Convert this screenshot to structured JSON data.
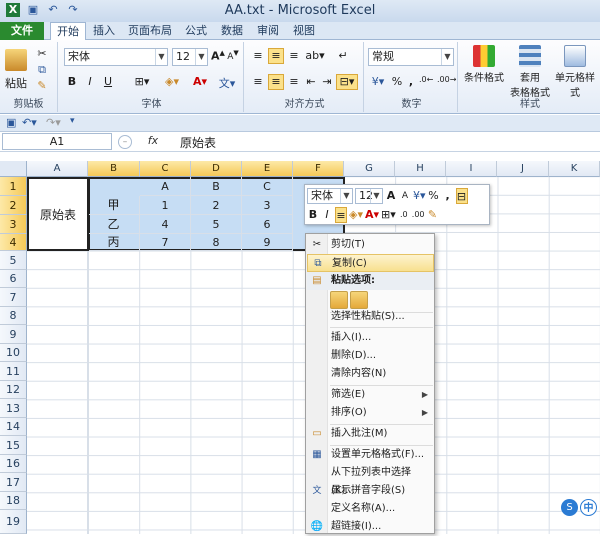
{
  "window": {
    "title": "AA.txt - Microsoft Excel"
  },
  "tabs": [
    {
      "label": "文件"
    },
    {
      "label": "开始"
    },
    {
      "label": "插入"
    },
    {
      "label": "页面布局"
    },
    {
      "label": "公式"
    },
    {
      "label": "数据"
    },
    {
      "label": "审阅"
    },
    {
      "label": "视图"
    }
  ],
  "ribbon": {
    "clipboard": {
      "paste": "粘贴",
      "label": "剪贴板"
    },
    "font": {
      "name": "宋体",
      "size": "12",
      "bold": "B",
      "italic": "I",
      "underline": "U",
      "label": "字体"
    },
    "alignment": {
      "label": "对齐方式"
    },
    "number": {
      "format": "常规",
      "percent": "%",
      "comma": ",",
      "label": "数字"
    },
    "styles": {
      "conditional": "条件格式",
      "table_line1": "套用",
      "table_line2": "表格格式",
      "cell_styles": "单元格样式",
      "label": "样式"
    }
  },
  "formula_bar": {
    "name_box": "A1",
    "fx": "fx",
    "value": "原始表"
  },
  "columns": [
    "A",
    "B",
    "C",
    "D",
    "E",
    "F",
    "G",
    "H",
    "I",
    "J",
    "K"
  ],
  "rows": [
    "1",
    "2",
    "3",
    "4",
    "5",
    "6",
    "7",
    "8",
    "9",
    "10",
    "11",
    "12",
    "13",
    "14",
    "15",
    "16",
    "17",
    "18",
    "19"
  ],
  "cells": {
    "a1": "原始表",
    "header": [
      "",
      "A",
      "B",
      "C",
      ""
    ],
    "r2": [
      "甲",
      "1",
      "2",
      "3"
    ],
    "r3": [
      "乙",
      "4",
      "5",
      "6"
    ],
    "r4": [
      "丙",
      "7",
      "8",
      "9"
    ]
  },
  "mini_toolbar": {
    "font": "宋体",
    "size": "12",
    "grow": "A",
    "shrink": "A",
    "percent": "%",
    "comma": ",",
    "bold": "B",
    "italic": "I"
  },
  "context_menu": {
    "items": [
      {
        "label": "剪切(T)",
        "icon": "scissors-icon"
      },
      {
        "label": "复制(C)",
        "icon": "copy-icon"
      },
      {
        "label": "粘贴选项:",
        "icon": "paste-icon"
      },
      {
        "label": "选择性粘贴(S)...",
        "icon": ""
      },
      {
        "label": "插入(I)...",
        "icon": ""
      },
      {
        "label": "删除(D)...",
        "icon": ""
      },
      {
        "label": "清除内容(N)",
        "icon": ""
      },
      {
        "label": "筛选(E)",
        "icon": ""
      },
      {
        "label": "排序(O)",
        "icon": ""
      },
      {
        "label": "插入批注(M)",
        "icon": "comment-icon"
      },
      {
        "label": "设置单元格格式(F)...",
        "icon": "format-cells-icon"
      },
      {
        "label": "从下拉列表中选择(K)...",
        "icon": ""
      },
      {
        "label": "显示拼音字段(S)",
        "icon": "phonetic-icon"
      },
      {
        "label": "定义名称(A)...",
        "icon": ""
      },
      {
        "label": "超链接(I)...",
        "icon": "hyperlink-icon"
      }
    ]
  },
  "ime": {
    "lang": "中"
  }
}
